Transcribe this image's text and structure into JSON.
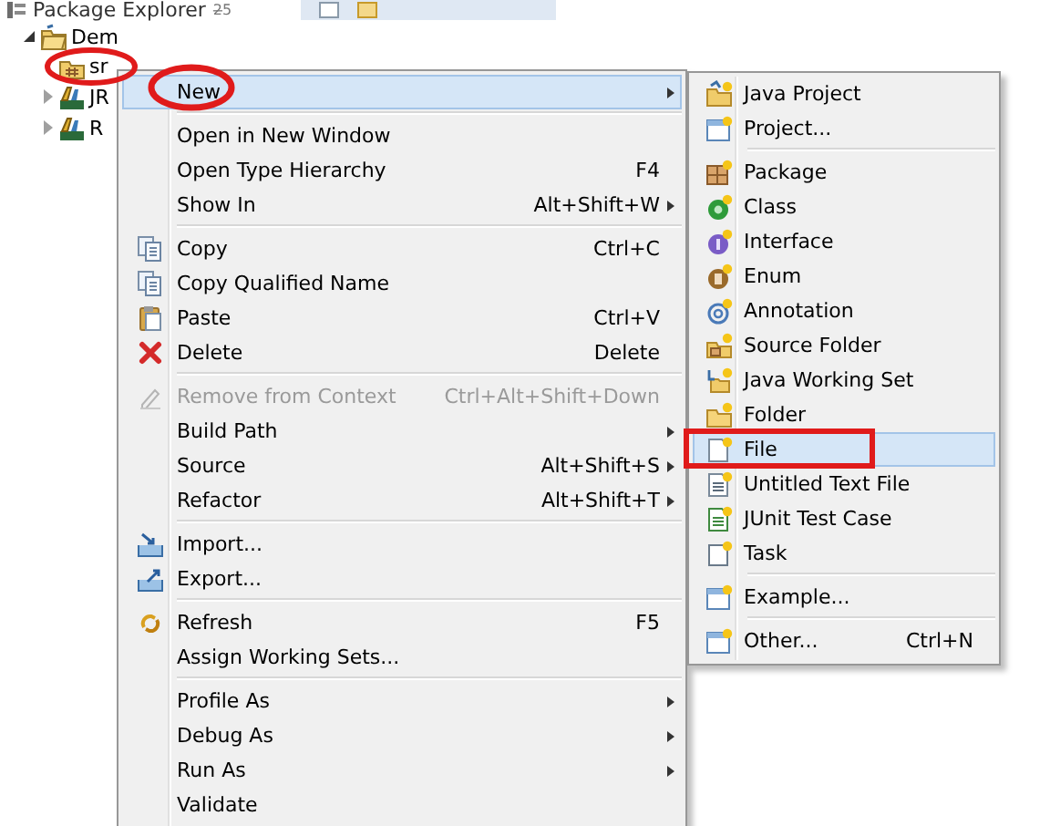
{
  "view": {
    "title": "Package Explorer",
    "tab_mark": "2̶5"
  },
  "tree": [
    {
      "label": "Dem",
      "kind": "project",
      "has_children": true,
      "expanded": true,
      "children": [
        {
          "label": "sr",
          "kind": "source-folder",
          "has_children": false,
          "expanded": false
        },
        {
          "label": "JR",
          "kind": "library",
          "has_children": true,
          "expanded": false
        },
        {
          "label": "R",
          "kind": "library",
          "has_children": true,
          "expanded": false
        }
      ]
    }
  ],
  "main_menu": {
    "items": [
      {
        "kind": "item",
        "label": "New",
        "submenu": true,
        "disabled": false,
        "selected": true
      },
      {
        "kind": "separator"
      },
      {
        "kind": "item",
        "label": "Open in New Window",
        "submenu": false,
        "disabled": false,
        "selected": false
      },
      {
        "kind": "item",
        "label": "Open Type Hierarchy",
        "shortcut": "F4",
        "submenu": false,
        "disabled": false,
        "selected": false
      },
      {
        "kind": "item",
        "label": "Show In",
        "shortcut": "Alt+Shift+W",
        "submenu": true,
        "disabled": false,
        "selected": false
      },
      {
        "kind": "separator"
      },
      {
        "kind": "item",
        "label": "Copy",
        "shortcut": "Ctrl+C",
        "submenu": false,
        "disabled": false,
        "selected": false
      },
      {
        "kind": "item",
        "label": "Copy Qualified Name",
        "submenu": false,
        "disabled": false,
        "selected": false
      },
      {
        "kind": "item",
        "label": "Paste",
        "shortcut": "Ctrl+V",
        "submenu": false,
        "disabled": false,
        "selected": false
      },
      {
        "kind": "item",
        "label": "Delete",
        "shortcut": "Delete",
        "submenu": false,
        "disabled": false,
        "selected": false
      },
      {
        "kind": "separator"
      },
      {
        "kind": "item",
        "label": "Remove from Context",
        "shortcut": "Ctrl+Alt+Shift+Down",
        "submenu": false,
        "disabled": true,
        "selected": false
      },
      {
        "kind": "item",
        "label": "Build Path",
        "submenu": true,
        "disabled": false,
        "selected": false
      },
      {
        "kind": "item",
        "label": "Source",
        "shortcut": "Alt+Shift+S",
        "submenu": true,
        "disabled": false,
        "selected": false
      },
      {
        "kind": "item",
        "label": "Refactor",
        "shortcut": "Alt+Shift+T",
        "submenu": true,
        "disabled": false,
        "selected": false
      },
      {
        "kind": "separator"
      },
      {
        "kind": "item",
        "label": "Import...",
        "submenu": false,
        "disabled": false,
        "selected": false
      },
      {
        "kind": "item",
        "label": "Export...",
        "submenu": false,
        "disabled": false,
        "selected": false
      },
      {
        "kind": "separator"
      },
      {
        "kind": "item",
        "label": "Refresh",
        "shortcut": "F5",
        "submenu": false,
        "disabled": false,
        "selected": false
      },
      {
        "kind": "item",
        "label": "Assign Working Sets...",
        "submenu": false,
        "disabled": false,
        "selected": false
      },
      {
        "kind": "separator"
      },
      {
        "kind": "item",
        "label": "Profile As",
        "submenu": true,
        "disabled": false,
        "selected": false
      },
      {
        "kind": "item",
        "label": "Debug As",
        "submenu": true,
        "disabled": false,
        "selected": false
      },
      {
        "kind": "item",
        "label": "Run As",
        "submenu": true,
        "disabled": false,
        "selected": false
      },
      {
        "kind": "item",
        "label": "Validate",
        "submenu": false,
        "disabled": false,
        "selected": false
      }
    ]
  },
  "new_submenu": {
    "items": [
      {
        "kind": "item",
        "label": "Java Project",
        "submenu": false,
        "disabled": false,
        "selected": false
      },
      {
        "kind": "item",
        "label": "Project...",
        "submenu": false,
        "disabled": false,
        "selected": false
      },
      {
        "kind": "separator"
      },
      {
        "kind": "item",
        "label": "Package",
        "submenu": false,
        "disabled": false,
        "selected": false
      },
      {
        "kind": "item",
        "label": "Class",
        "submenu": false,
        "disabled": false,
        "selected": false
      },
      {
        "kind": "item",
        "label": "Interface",
        "submenu": false,
        "disabled": false,
        "selected": false
      },
      {
        "kind": "item",
        "label": "Enum",
        "submenu": false,
        "disabled": false,
        "selected": false
      },
      {
        "kind": "item",
        "label": "Annotation",
        "submenu": false,
        "disabled": false,
        "selected": false
      },
      {
        "kind": "item",
        "label": "Source Folder",
        "submenu": false,
        "disabled": false,
        "selected": false
      },
      {
        "kind": "item",
        "label": "Java Working Set",
        "submenu": false,
        "disabled": false,
        "selected": false
      },
      {
        "kind": "item",
        "label": "Folder",
        "submenu": false,
        "disabled": false,
        "selected": false
      },
      {
        "kind": "item",
        "label": "File",
        "submenu": false,
        "disabled": false,
        "selected": true
      },
      {
        "kind": "item",
        "label": "Untitled Text File",
        "submenu": false,
        "disabled": false,
        "selected": false
      },
      {
        "kind": "item",
        "label": "JUnit Test Case",
        "submenu": false,
        "disabled": false,
        "selected": false
      },
      {
        "kind": "item",
        "label": "Task",
        "submenu": false,
        "disabled": false,
        "selected": false
      },
      {
        "kind": "separator"
      },
      {
        "kind": "item",
        "label": "Example...",
        "submenu": false,
        "disabled": false,
        "selected": false
      },
      {
        "kind": "separator"
      },
      {
        "kind": "item",
        "label": "Other...",
        "shortcut": "Ctrl+N",
        "submenu": false,
        "disabled": false,
        "selected": false
      }
    ]
  }
}
